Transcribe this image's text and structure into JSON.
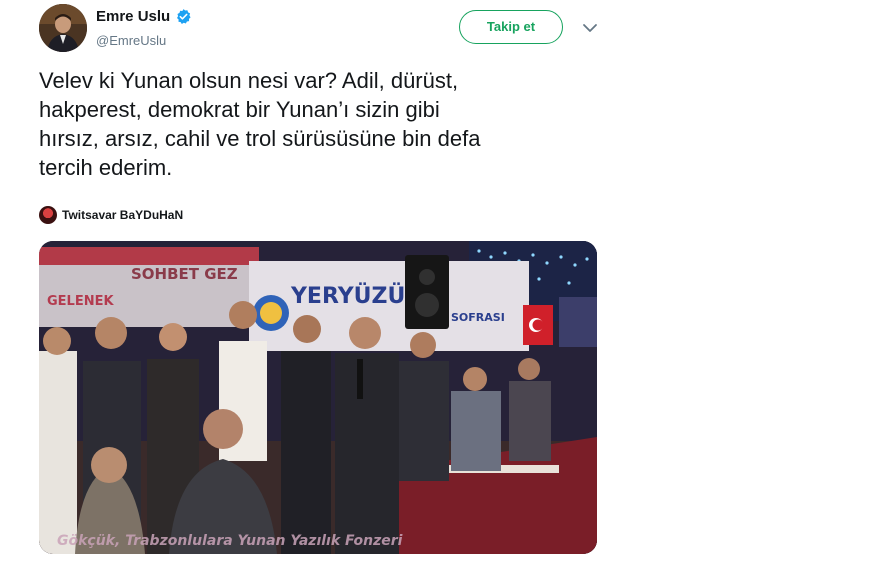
{
  "author": {
    "display_name": "Emre Uslu",
    "handle": "@EmreUslu",
    "verified": true,
    "avatar_icon": "avatar-photo"
  },
  "actions": {
    "follow_label": "Takip et",
    "menu_icon": "chevron-down-icon"
  },
  "tweet": {
    "text": "Velev ki Yunan olsun nesi var? Adil, dürüst,\nhakperest, demokrat bir Yunan’ı sizin gibi\nhırsız, arsız, cahil ve trol sürüsüsüne bin defa\ntercih ederim."
  },
  "attribution": {
    "name": "Twitsavar BaYDuHaN"
  },
  "media": {
    "banner_left": "SOHBET GEZ",
    "banner_left_sub": "GELENEK",
    "banner_main": "YERYÜZÜ K",
    "banner_main_sub": "SOFRASI",
    "subtitle": "Gökçük, Trabzonlulara Yunan Yazılık Fonzeri"
  },
  "colors": {
    "follow_green": "#17a35e",
    "verified_blue": "#1da1f2",
    "text": "#14171a",
    "secondary": "#657786"
  }
}
